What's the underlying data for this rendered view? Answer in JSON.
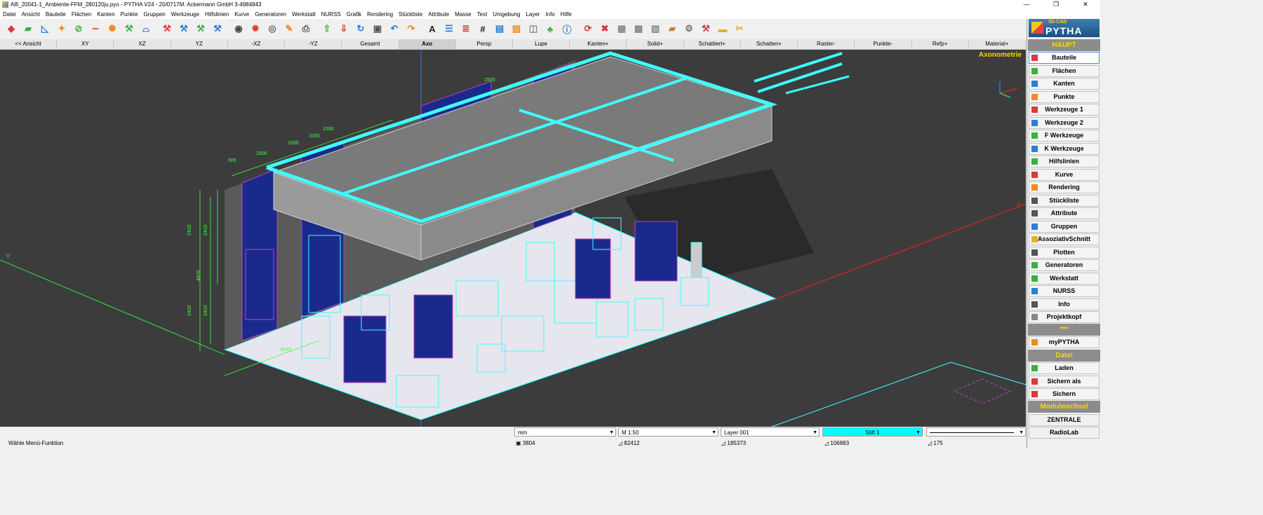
{
  "window": {
    "title": "Alfi_20041-1_Ambiente-FFM_280120ju.pyo - PYTHA V24 - 20/0717M. Ackermann GmbH   3-4984843",
    "buttons": [
      "—",
      "❐",
      "✕"
    ]
  },
  "menu": [
    "Datei",
    "Ansicht",
    "Bauteile",
    "Flächen",
    "Kanten",
    "Punkte",
    "Gruppen",
    "Werkzeuge",
    "Hilfslinien",
    "Kurve",
    "Generatoren",
    "Werkstatt",
    "NURSS",
    "Grafik",
    "Rendering",
    "Stückliste",
    "Attribute",
    "Masse",
    "Text",
    "Umgebung",
    "Layer",
    "Info",
    "Hilfe"
  ],
  "toolbar": {
    "icons": [
      {
        "name": "bauteil-icon",
        "glyph": "◆",
        "color": "#d93a3a"
      },
      {
        "name": "flaeche-icon",
        "glyph": "▰",
        "color": "#3cb043"
      },
      {
        "name": "kante-icon",
        "glyph": "◺",
        "color": "#2a7fd4"
      },
      {
        "name": "punkte-icon",
        "glyph": "✦",
        "color": "#f08a24"
      },
      {
        "name": "hilfslinien-icon",
        "glyph": "⊘",
        "color": "#3cb043"
      },
      {
        "name": "kurve-icon",
        "glyph": "∼",
        "color": "#d93a3a"
      },
      {
        "name": "generator-icon",
        "glyph": "✺",
        "color": "#f08a24"
      },
      {
        "name": "werkstatt-icon",
        "glyph": "⚒",
        "color": "#3cb043"
      },
      {
        "name": "nurss-icon",
        "glyph": "⌓",
        "color": "#2a7fd4"
      },
      {
        "name": "werkzeug1-icon",
        "glyph": "⚒",
        "color": "#d93a3a"
      },
      {
        "name": "werkzeug2-icon",
        "glyph": "⚒",
        "color": "#2a7fd4"
      },
      {
        "name": "fwerkzeug-icon",
        "glyph": "⚒",
        "color": "#3cb043"
      },
      {
        "name": "kwerkzeug-icon",
        "glyph": "⚒",
        "color": "#2a7fd4"
      },
      {
        "name": "camera-icon",
        "glyph": "◉",
        "color": "#444444"
      },
      {
        "name": "render-icon",
        "glyph": "✹",
        "color": "#d93a3a"
      },
      {
        "name": "eye-icon",
        "glyph": "◎",
        "color": "#666666"
      },
      {
        "name": "pen-icon",
        "glyph": "✎",
        "color": "#f08a24"
      },
      {
        "name": "print-icon",
        "glyph": "⎙",
        "color": "#555555"
      },
      {
        "name": "export-icon",
        "glyph": "⇧",
        "color": "#3cb043"
      },
      {
        "name": "import-icon",
        "glyph": "⇩",
        "color": "#d93a3a"
      },
      {
        "name": "rotate-icon",
        "glyph": "↻",
        "color": "#2a7fd4"
      },
      {
        "name": "cup-icon",
        "glyph": "▣",
        "color": "#555555"
      },
      {
        "name": "undo-icon",
        "glyph": "↶",
        "color": "#2a7fd4"
      },
      {
        "name": "redo-icon",
        "glyph": "↷",
        "color": "#f08a24"
      },
      {
        "name": "attr-icon",
        "glyph": "A",
        "color": "#222222"
      },
      {
        "name": "list-icon",
        "glyph": "☰",
        "color": "#2a7fd4"
      },
      {
        "name": "layer-list-icon",
        "glyph": "≣",
        "color": "#d93a3a"
      },
      {
        "name": "counter-icon",
        "glyph": "#",
        "color": "#222222"
      },
      {
        "name": "pages-icon",
        "glyph": "▤",
        "color": "#2a7fd4"
      },
      {
        "name": "hatch-icon",
        "glyph": "▨",
        "color": "#f08a24"
      },
      {
        "name": "layers-icon",
        "glyph": "◫",
        "color": "#888888"
      },
      {
        "name": "tree-icon",
        "glyph": "♣",
        "color": "#3cb043"
      },
      {
        "name": "info-icon",
        "glyph": "ⓘ",
        "color": "#2a7fd4"
      },
      {
        "name": "cycle-icon",
        "glyph": "⟳",
        "color": "#d93a3a"
      },
      {
        "name": "delete-icon",
        "glyph": "✖",
        "color": "#d93a3a"
      },
      {
        "name": "box-icon",
        "glyph": "▦",
        "color": "#888888"
      },
      {
        "name": "boxes-icon",
        "glyph": "▩",
        "color": "#888888"
      },
      {
        "name": "box-tool-icon",
        "glyph": "▧",
        "color": "#888888"
      },
      {
        "name": "package-icon",
        "glyph": "▰",
        "color": "#c08040"
      },
      {
        "name": "wrench-icon",
        "glyph": "⚙",
        "color": "#777777"
      },
      {
        "name": "hammer-icon",
        "glyph": "⚒",
        "color": "#c04040"
      },
      {
        "name": "folder-icon",
        "glyph": "▬",
        "color": "#e0b030"
      },
      {
        "name": "scissors-icon",
        "glyph": "✂",
        "color": "#e0b030"
      }
    ]
  },
  "viewbar": [
    "<< Ansicht",
    "XY",
    "XZ",
    "YZ",
    "-XZ",
    "-YZ",
    "Gesamt",
    "Axo",
    "Persp",
    "Lupe",
    "Kanten+",
    "Solid+",
    "Schattiert+",
    "Schatten+",
    "Raster-",
    "Punkte-",
    "Refp+",
    "Material+"
  ],
  "viewbar_active": "Axo",
  "viewport": {
    "label": "Axonometrie",
    "axis_y": "Y",
    "axis_x": "X",
    "dims_left": [
      "2410",
      "2410",
      "4820",
      "2410",
      "2410"
    ],
    "dims_top": [
      "1500",
      "1500",
      "1000",
      "1000",
      "1500",
      "505",
      "6045"
    ]
  },
  "panel": {
    "logo_small": "3D-CAD",
    "logo_big": "PYTHA",
    "hdr_main": "HAUPT",
    "items": [
      "Bauteile",
      "Flächen",
      "Kanten",
      "Punkte",
      "Werkzeuge 1",
      "Werkzeuge 2",
      "F Werkzeuge",
      "K Werkzeuge",
      "Hilfslinien",
      "Kurve",
      "Rendering",
      "Stückliste",
      "Attribute",
      "Gruppen",
      "AssoziativSchnitt",
      "Plotten",
      "Generatoren",
      "Werkstatt",
      "NURSS",
      "Info",
      "Projektkopf"
    ],
    "stars": "***",
    "my": "myPYTHA",
    "hdr_datei": "Datei",
    "datei_items": [
      "Laden",
      "Sichern als",
      "Sichern"
    ],
    "hdr_modul": "Modulwechsel",
    "modul_items": [
      "ZENTRALE",
      "RadioLab"
    ]
  },
  "status": {
    "unit": "mm",
    "scale": "M 1:50",
    "layer": "Layer 001",
    "pen": "Stift 1",
    "pen_color": "#00ffff",
    "message": "Wähle Menü-Funktion",
    "v1": "3804",
    "v2": "82412",
    "v3": "185373",
    "v4": "106883",
    "v5": "175"
  }
}
